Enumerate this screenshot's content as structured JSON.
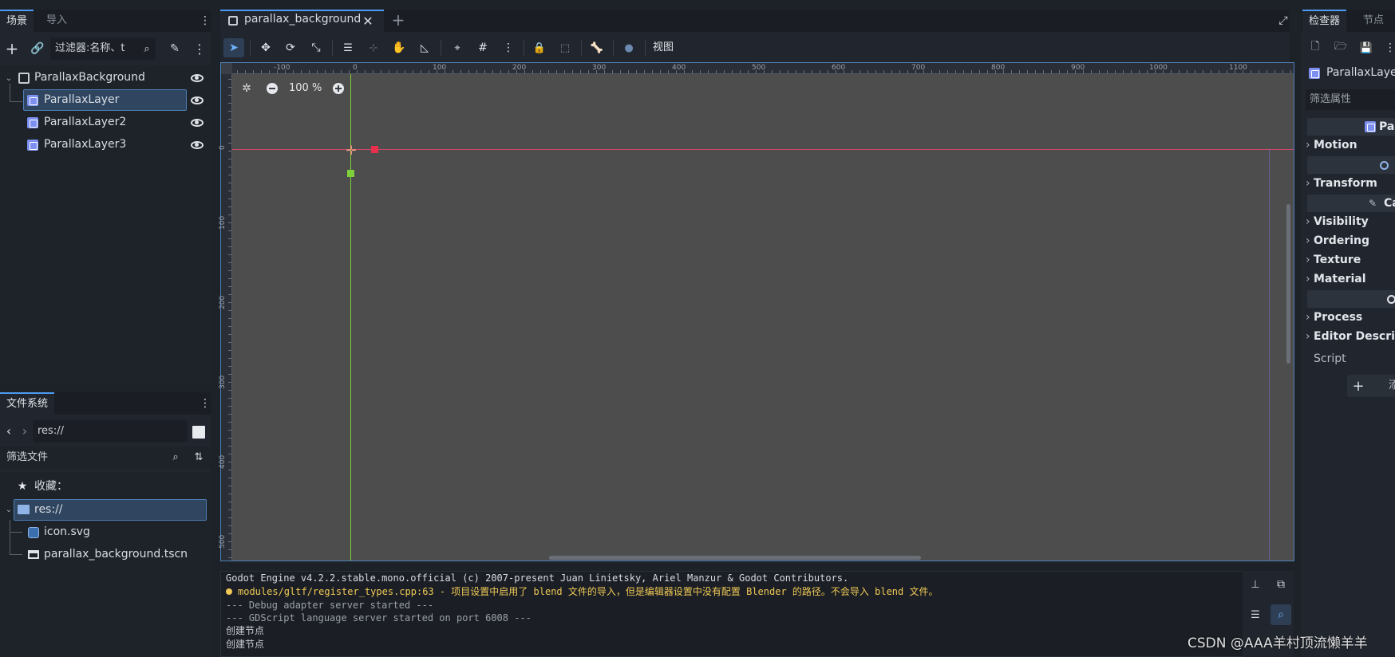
{
  "scene_dock": {
    "tabs": [
      "场景",
      "导入"
    ],
    "filter_placeholder": "过滤器:名称、t",
    "tree": [
      {
        "label": "ParallaxBackground",
        "selected": false
      },
      {
        "label": "ParallaxLayer",
        "selected": true
      },
      {
        "label": "ParallaxLayer2",
        "selected": false
      },
      {
        "label": "ParallaxLayer3",
        "selected": false
      }
    ]
  },
  "filesystem_dock": {
    "tab": "文件系统",
    "path": "res://",
    "filter_placeholder": "筛选文件",
    "favorites_label": "收藏：",
    "root": "res://",
    "files": [
      "icon.svg",
      "parallax_background.tscn"
    ]
  },
  "editor": {
    "scene_tab": "parallax_background",
    "view_menu": "视图",
    "zoom": "100 %",
    "ruler_h": [
      "-100",
      "0",
      "100",
      "200",
      "300",
      "400",
      "500",
      "600",
      "700",
      "800",
      "900",
      "1000",
      "1100"
    ],
    "ruler_v": [
      "0",
      "100",
      "200",
      "300",
      "400",
      "500"
    ]
  },
  "console": {
    "lines": [
      {
        "text": "Godot Engine v4.2.2.stable.mono.official (c) 2007-present Juan Linietsky, Ariel Manzur & Godot Contributors.",
        "kind": "normal"
      },
      {
        "text": "modules/gltf/register_types.cpp:63 - 项目设置中启用了 blend 文件的导入，但是编辑器设置中没有配置 Blender 的路径。不会导入 blend 文件。",
        "kind": "warning"
      },
      {
        "text": "--- Debug adapter server started ---",
        "kind": "dim"
      },
      {
        "text": "--- GDScript language server started on port 6008 ---",
        "kind": "dim"
      },
      {
        "text": "创建节点",
        "kind": "normal"
      },
      {
        "text": "创建节点",
        "kind": "normal"
      }
    ]
  },
  "inspector": {
    "tabs": [
      "检查器",
      "节点"
    ],
    "node_name": "ParallaxLayer",
    "filter_placeholder": "筛选属性",
    "class_header": "Pa",
    "sections": [
      "Motion",
      "Transform",
      "Visibility",
      "Ordering",
      "Texture",
      "Material",
      "Process",
      "Editor Descrip"
    ],
    "canvas_header": "Ca",
    "script_label": "Script",
    "add_label": "添"
  },
  "watermark": "CSDN @AAA羊村顶流懒羊羊",
  "colors": {
    "accent": "#4d9bf2",
    "viewport_bg": "#4d4d4d",
    "guide_red": "#e04a6a",
    "guide_green": "#7fd13b",
    "warning": "#f0c956"
  }
}
